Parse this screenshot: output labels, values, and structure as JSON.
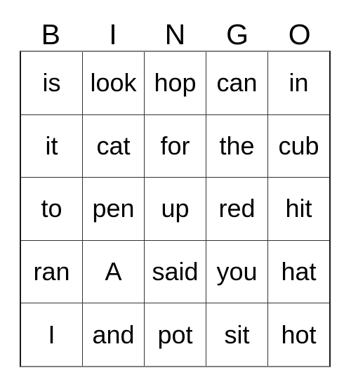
{
  "card": {
    "title": "BINGO",
    "columns": [
      "B",
      "I",
      "N",
      "G",
      "O"
    ],
    "rows": [
      [
        "is",
        "look",
        "hop",
        "can",
        "in"
      ],
      [
        "it",
        "cat",
        "for",
        "the",
        "cub"
      ],
      [
        "to",
        "pen",
        "up",
        "red",
        "hit"
      ],
      [
        "ran",
        "A",
        "said",
        "you",
        "hat"
      ],
      [
        "I",
        "and",
        "pot",
        "sit",
        "hot"
      ]
    ],
    "colors": {
      "background": "#ffffff",
      "text": "#000000",
      "grid_line": "#333333",
      "grid_border": "#1a1a1a"
    }
  }
}
